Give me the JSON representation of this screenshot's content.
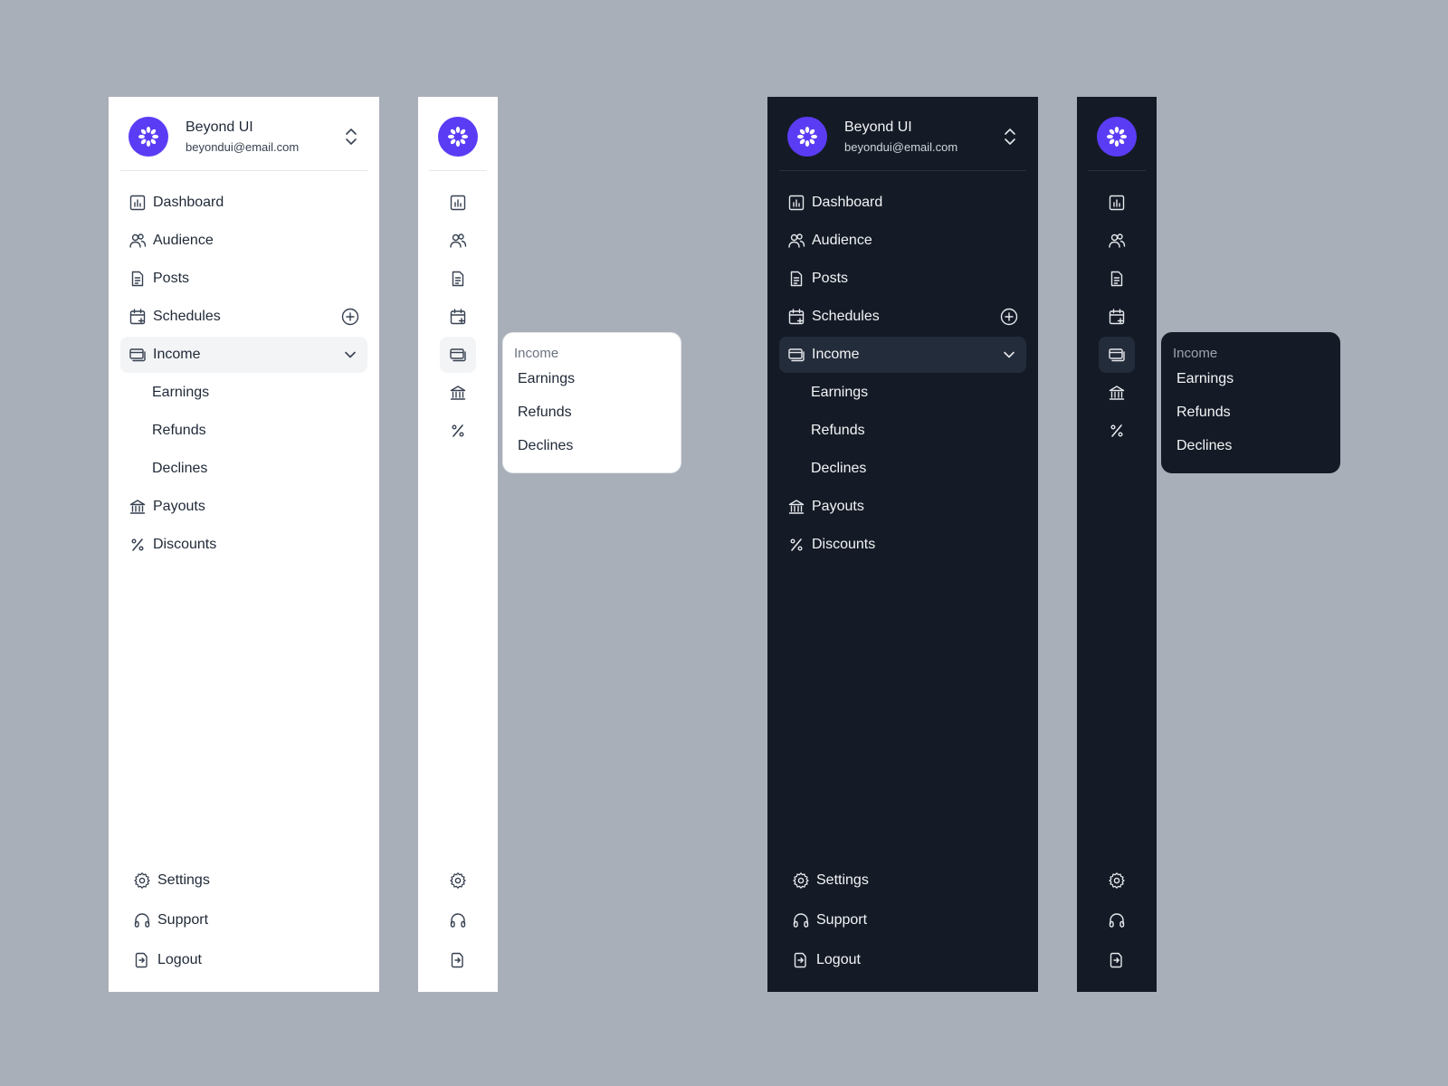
{
  "user": {
    "name": "Beyond UI",
    "email": "beyondui@email.com"
  },
  "nav": {
    "dashboard": "Dashboard",
    "audience": "Audience",
    "posts": "Posts",
    "schedules": "Schedules",
    "income": "Income",
    "earnings": "Earnings",
    "refunds": "Refunds",
    "declines": "Declines",
    "payouts": "Payouts",
    "discounts": "Discounts"
  },
  "bottom": {
    "settings": "Settings",
    "support": "Support",
    "logout": "Logout"
  },
  "popover": {
    "title": "Income",
    "items": [
      "Earnings",
      "Refunds",
      "Declines"
    ]
  },
  "colors": {
    "background": "#A9AFB8",
    "brand": "#5B3CF5",
    "dark_panel": "#141B26",
    "light_panel": "#FFFFFF"
  }
}
